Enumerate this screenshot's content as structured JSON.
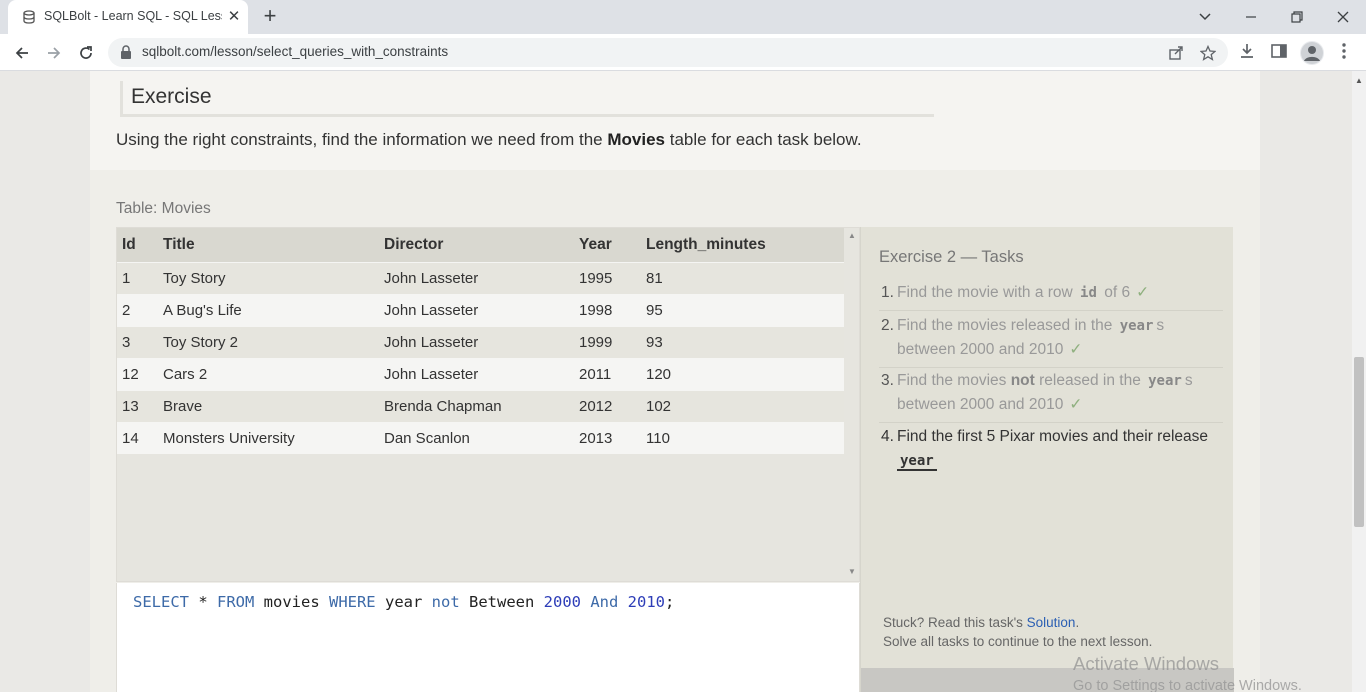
{
  "browser": {
    "tab_title": "SQLBolt - Learn SQL - SQL Lesson",
    "url": "sqlbolt.com/lesson/select_queries_with_constraints"
  },
  "page": {
    "exercise_heading": "Exercise",
    "intro_before": "Using the right constraints, find the information we need from the ",
    "intro_bold": "Movies",
    "intro_after": " table for each task below.",
    "table_caption": "Table: Movies",
    "table": {
      "columns": [
        "Id",
        "Title",
        "Director",
        "Year",
        "Length_minutes"
      ],
      "rows": [
        [
          "1",
          "Toy Story",
          "John Lasseter",
          "1995",
          "81"
        ],
        [
          "2",
          "A Bug's Life",
          "John Lasseter",
          "1998",
          "95"
        ],
        [
          "3",
          "Toy Story 2",
          "John Lasseter",
          "1999",
          "93"
        ],
        [
          "12",
          "Cars 2",
          "John Lasseter",
          "2011",
          "120"
        ],
        [
          "13",
          "Brave",
          "Brenda Chapman",
          "2012",
          "102"
        ],
        [
          "14",
          "Monsters University",
          "Dan Scanlon",
          "2013",
          "110"
        ]
      ]
    },
    "query": {
      "t1": "SELECT",
      "t2": " * ",
      "t3": "FROM",
      "t4": " movies ",
      "t5": "WHERE",
      "t6": " year ",
      "t7": "not",
      "t8": " Between ",
      "t9": "2000",
      "t10": " ",
      "t11": "And",
      "t12": " ",
      "t13": "2010",
      "t14": ";"
    },
    "tasks_title": "Exercise 2 — Tasks",
    "tasks": [
      {
        "num": "1.",
        "a": "Find the movie with a row ",
        "code": "id",
        "b": " of 6",
        "check": "✓"
      },
      {
        "num": "2.",
        "a": "Find the movies released in the ",
        "code": "year",
        "b": "s between 2000 and 2010",
        "check": "✓"
      },
      {
        "num": "3.",
        "a": "Find the movies ",
        "bold": "not",
        "a2": " released in the ",
        "code": "year",
        "b": "s between 2000 and 2010",
        "check": "✓"
      },
      {
        "num": "4.",
        "a": "Find the first 5 Pixar movies and their release ",
        "code": "year"
      }
    ],
    "stuck_text": "Stuck? Read this task's ",
    "solution_link": "Solution",
    "stuck_period": ".",
    "continue_text": "Solve all tasks to continue to the next lesson."
  },
  "watermark": {
    "line1": "Activate Windows",
    "line2": "Go to Settings to activate Windows."
  }
}
